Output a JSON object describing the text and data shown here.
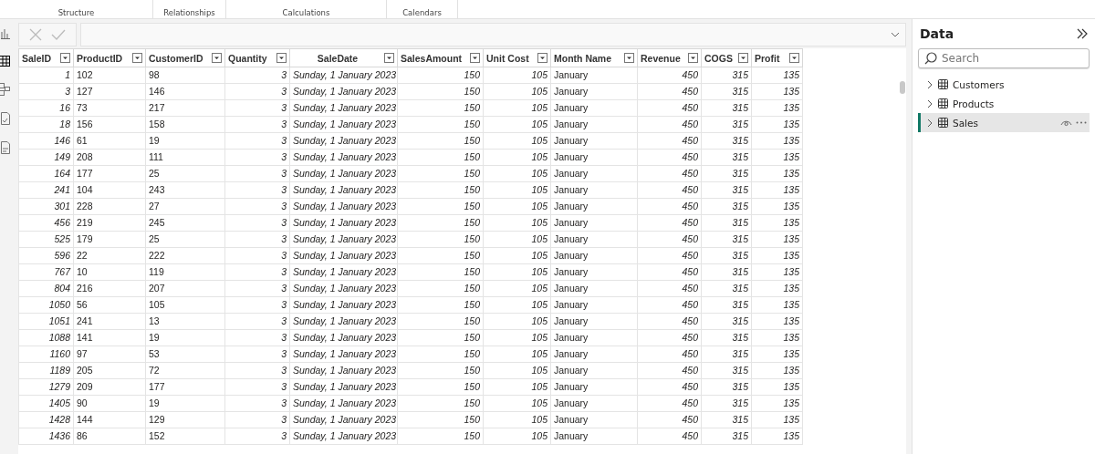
{
  "ribbon": {
    "groups": [
      "Structure",
      "Relationships",
      "Calculations",
      "Calendars"
    ]
  },
  "view_rail": [
    {
      "kind": "report",
      "selected": false
    },
    {
      "kind": "table",
      "selected": true
    },
    {
      "kind": "model",
      "selected": false
    },
    {
      "kind": "query",
      "selected": false
    },
    {
      "kind": "tmdl",
      "selected": false
    }
  ],
  "table": {
    "columns": [
      {
        "label": "SaleID",
        "kind": "number"
      },
      {
        "label": "ProductID",
        "kind": "text"
      },
      {
        "label": "CustomerID",
        "kind": "text"
      },
      {
        "label": "Quantity",
        "kind": "number"
      },
      {
        "label": "SaleDate",
        "kind": "date"
      },
      {
        "label": "SalesAmount",
        "kind": "number"
      },
      {
        "label": "Unit Cost",
        "kind": "number"
      },
      {
        "label": "Month Name",
        "kind": "text"
      },
      {
        "label": "Revenue",
        "kind": "number"
      },
      {
        "label": "COGS",
        "kind": "number"
      },
      {
        "label": "Profit",
        "kind": "number"
      }
    ],
    "rows": [
      [
        "1",
        "102",
        "98",
        "3",
        "Sunday, 1 January 2023",
        "150",
        "105",
        "January",
        "450",
        "315",
        "135"
      ],
      [
        "3",
        "127",
        "146",
        "3",
        "Sunday, 1 January 2023",
        "150",
        "105",
        "January",
        "450",
        "315",
        "135"
      ],
      [
        "16",
        "73",
        "217",
        "3",
        "Sunday, 1 January 2023",
        "150",
        "105",
        "January",
        "450",
        "315",
        "135"
      ],
      [
        "18",
        "156",
        "158",
        "3",
        "Sunday, 1 January 2023",
        "150",
        "105",
        "January",
        "450",
        "315",
        "135"
      ],
      [
        "146",
        "61",
        "19",
        "3",
        "Sunday, 1 January 2023",
        "150",
        "105",
        "January",
        "450",
        "315",
        "135"
      ],
      [
        "149",
        "208",
        "111",
        "3",
        "Sunday, 1 January 2023",
        "150",
        "105",
        "January",
        "450",
        "315",
        "135"
      ],
      [
        "164",
        "177",
        "25",
        "3",
        "Sunday, 1 January 2023",
        "150",
        "105",
        "January",
        "450",
        "315",
        "135"
      ],
      [
        "241",
        "104",
        "243",
        "3",
        "Sunday, 1 January 2023",
        "150",
        "105",
        "January",
        "450",
        "315",
        "135"
      ],
      [
        "301",
        "228",
        "27",
        "3",
        "Sunday, 1 January 2023",
        "150",
        "105",
        "January",
        "450",
        "315",
        "135"
      ],
      [
        "456",
        "219",
        "245",
        "3",
        "Sunday, 1 January 2023",
        "150",
        "105",
        "January",
        "450",
        "315",
        "135"
      ],
      [
        "525",
        "179",
        "25",
        "3",
        "Sunday, 1 January 2023",
        "150",
        "105",
        "January",
        "450",
        "315",
        "135"
      ],
      [
        "596",
        "22",
        "222",
        "3",
        "Sunday, 1 January 2023",
        "150",
        "105",
        "January",
        "450",
        "315",
        "135"
      ],
      [
        "767",
        "10",
        "119",
        "3",
        "Sunday, 1 January 2023",
        "150",
        "105",
        "January",
        "450",
        "315",
        "135"
      ],
      [
        "804",
        "216",
        "207",
        "3",
        "Sunday, 1 January 2023",
        "150",
        "105",
        "January",
        "450",
        "315",
        "135"
      ],
      [
        "1050",
        "56",
        "105",
        "3",
        "Sunday, 1 January 2023",
        "150",
        "105",
        "January",
        "450",
        "315",
        "135"
      ],
      [
        "1051",
        "241",
        "13",
        "3",
        "Sunday, 1 January 2023",
        "150",
        "105",
        "January",
        "450",
        "315",
        "135"
      ],
      [
        "1088",
        "141",
        "19",
        "3",
        "Sunday, 1 January 2023",
        "150",
        "105",
        "January",
        "450",
        "315",
        "135"
      ],
      [
        "1160",
        "97",
        "53",
        "3",
        "Sunday, 1 January 2023",
        "150",
        "105",
        "January",
        "450",
        "315",
        "135"
      ],
      [
        "1189",
        "205",
        "72",
        "3",
        "Sunday, 1 January 2023",
        "150",
        "105",
        "January",
        "450",
        "315",
        "135"
      ],
      [
        "1279",
        "209",
        "177",
        "3",
        "Sunday, 1 January 2023",
        "150",
        "105",
        "January",
        "450",
        "315",
        "135"
      ],
      [
        "1405",
        "90",
        "19",
        "3",
        "Sunday, 1 January 2023",
        "150",
        "105",
        "January",
        "450",
        "315",
        "135"
      ],
      [
        "1428",
        "144",
        "129",
        "3",
        "Sunday, 1 January 2023",
        "150",
        "105",
        "January",
        "450",
        "315",
        "135"
      ],
      [
        "1436",
        "86",
        "152",
        "3",
        "Sunday, 1 January 2023",
        "150",
        "105",
        "January",
        "450",
        "315",
        "135"
      ]
    ]
  },
  "data_pane": {
    "title": "Data",
    "search": {
      "placeholder": "Search"
    },
    "tables": [
      {
        "name": "Customers",
        "selected": false,
        "expanded": false
      },
      {
        "name": "Products",
        "selected": false,
        "expanded": false
      },
      {
        "name": "Sales",
        "selected": true,
        "expanded": false
      }
    ]
  }
}
